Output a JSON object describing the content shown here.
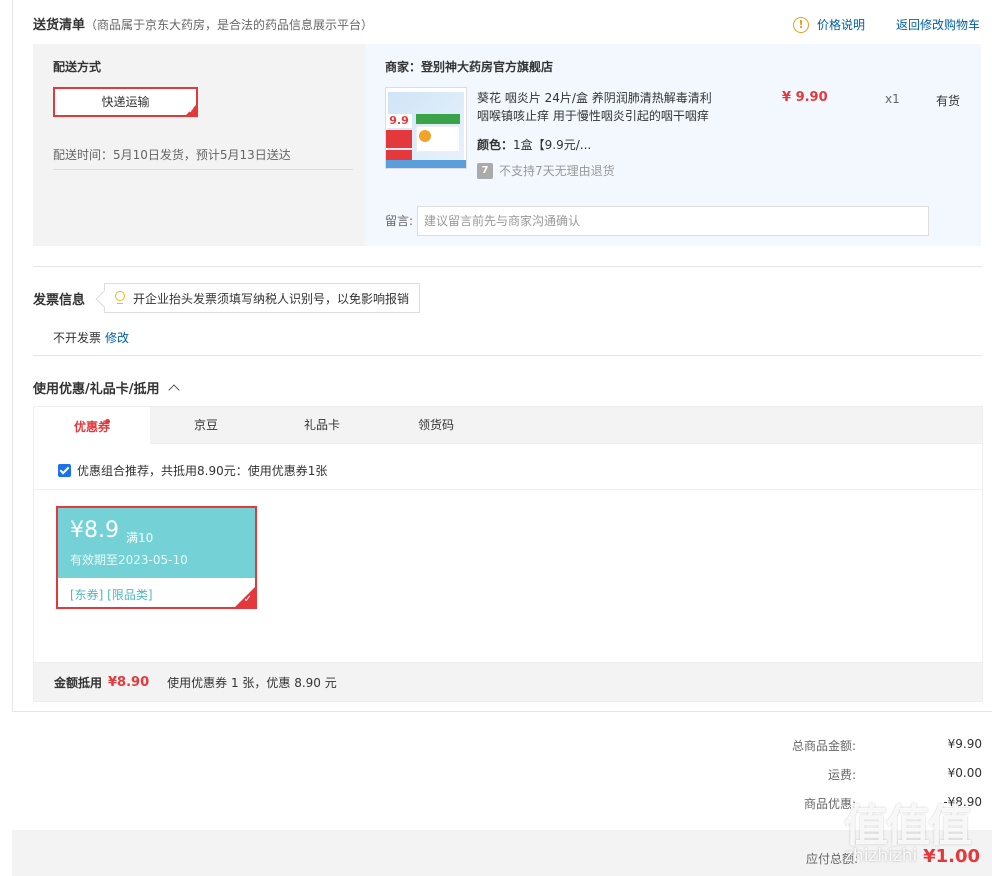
{
  "shipping": {
    "title": "送货清单",
    "note": "（商品属于京东大药房，是合法的药品信息展示平台）",
    "price_note_label": "价格说明",
    "back_to_cart": "返回修改购物车",
    "method_label": "配送方式",
    "method_value": "快递运输",
    "delivery_time": "配送时间：5月10日发货，预计5月13日送达"
  },
  "order": {
    "merchant": "商家：登别神大药房官方旗舰店",
    "product_title": "葵花 咽炎片 24片/盒 养阴润肺清热解毒清利咽喉镇咳止痒 用于慢性咽炎引起的咽干咽痒",
    "color_label": "颜色：",
    "color_value": "1盒【9.9元/...",
    "no_return": "不支持7天无理由退货",
    "no_return_icon": "7",
    "price": "¥ 9.90",
    "qty": "x1",
    "stock": "有货",
    "remark_label": "留言:",
    "remark_placeholder": "建议留言前先与商家沟通确认",
    "image_text": "9.9"
  },
  "invoice": {
    "title": "发票信息",
    "tip": "开企业抬头发票须填写纳税人识别号，以免影响报销",
    "value": "不开发票",
    "edit": "修改"
  },
  "coupon": {
    "title": "使用优惠/礼品卡/抵用",
    "tabs": [
      {
        "label": "优惠券"
      },
      {
        "label": "京豆"
      },
      {
        "label": "礼品卡"
      },
      {
        "label": "领货码"
      }
    ],
    "recommend": "优惠组合推荐，共抵用8.90元：使用优惠券1张",
    "card": {
      "amount": "¥8.9",
      "condition": "满10",
      "valid": "有效期至2023-05-10",
      "tags": "[东券] [限品类]"
    },
    "deduct_label": "金额抵用",
    "deduct_amount": "¥8.90",
    "deduct_desc": "使用优惠券 1 张，优惠 8.90 元"
  },
  "totals": {
    "goods_label": "总商品金额:",
    "goods_value": "¥9.90",
    "shipping_label": "运费:",
    "shipping_value": "¥0.00",
    "discount_label": "商品优惠:",
    "discount_value": "-¥8.90",
    "payable_label": "应付总额:",
    "payable_value": "¥1.00"
  },
  "watermark": {
    "big": "值值值",
    "small": "zhizhizhi"
  },
  "colors": {
    "accent_red": "#e4393c",
    "link_blue": "#005ea7",
    "coupon_teal": "#74d2d6"
  }
}
